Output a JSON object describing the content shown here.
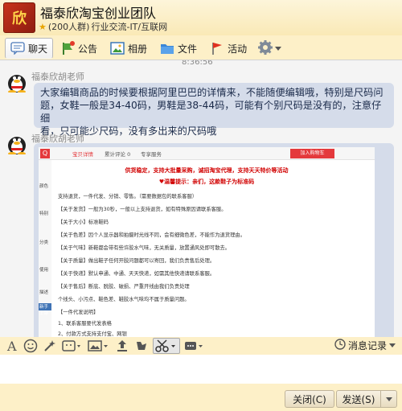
{
  "header": {
    "logo_text": "欣",
    "group_name": "福泰欣淘宝创业团队",
    "member_count": "(200人群)",
    "category": "行业交流-IT/互联网"
  },
  "tabs": [
    {
      "label": "聊天",
      "icon": "chat-icon"
    },
    {
      "label": "公告",
      "icon": "announcement-icon"
    },
    {
      "label": "相册",
      "icon": "album-icon"
    },
    {
      "label": "文件",
      "icon": "folder-icon"
    },
    {
      "label": "活动",
      "icon": "flag-icon"
    }
  ],
  "chat": {
    "timestamp": "8:36:56",
    "messages": [
      {
        "sender": "福泰欣胡老师",
        "lines": [
          "大家编辑商品的时候要根据阿里巴巴的详情来，不能随便编辑哦，特别是尺码问",
          "题，女鞋一般是34-40码，男鞋是38-44码，可能有个别尺码是没有的，注意仔细",
          "看，只可能少尺码，没有多出来的尺码哦"
        ]
      },
      {
        "sender": "福泰欣胡老师",
        "image": {
          "tabs": [
            "宝贝详情",
            "累计评论 0",
            "专享服务"
          ],
          "cart_button": "加入购物车",
          "side_labels": [
            "颜色",
            "特别",
            "分类",
            "使用",
            "描述",
            "新手上路"
          ],
          "headlines": [
            "供货稳定，支持大批量采购，诚招淘宝代理，支持天天特价等活动",
            "♥温馨提示：亲们，这款鞋子为标准码"
          ],
          "lines": [
            "支持退货，一件代发、分销、零售。（需要数据包的联系客服）",
            "【关于发货】一般为30秒，一般以上支持退货，如有特殊原因请联系客服。",
            "【关于大小】标准鞋码",
            "【关于色差】因个人显示器和拍摄时光线不同，会有细微色差，不能作为退货理由。",
            "【关于气味】新鞋都会带有些许胶水气味，无关质量，放置通风处即可散去。",
            "【关于质量】做出鞋子任何开胶问题都可以寄回，我们负责售后处理。",
            "【关于快递】默认申通、中通、天天快递，如需其他快递请联系客服。",
            "【关于售后】断底、脱胶、破损、严重开线由我们负责处理",
            "个线头、小污点、鞋色差、鞋胶水气味均不属于质量问题。",
            "【一件代发说明】",
            "1、联系客服要代发表格",
            "2、付款方式支持支付宝、网银"
          ]
        }
      }
    ]
  },
  "toolbar": {
    "history_label": "消息记录"
  },
  "footer": {
    "close_label": "关闭(C)",
    "send_label": "发送(S)"
  },
  "colors": {
    "bubble": "#d5dcea",
    "header_bg": "#fdf0c8",
    "accent_red": "#e4393c"
  }
}
